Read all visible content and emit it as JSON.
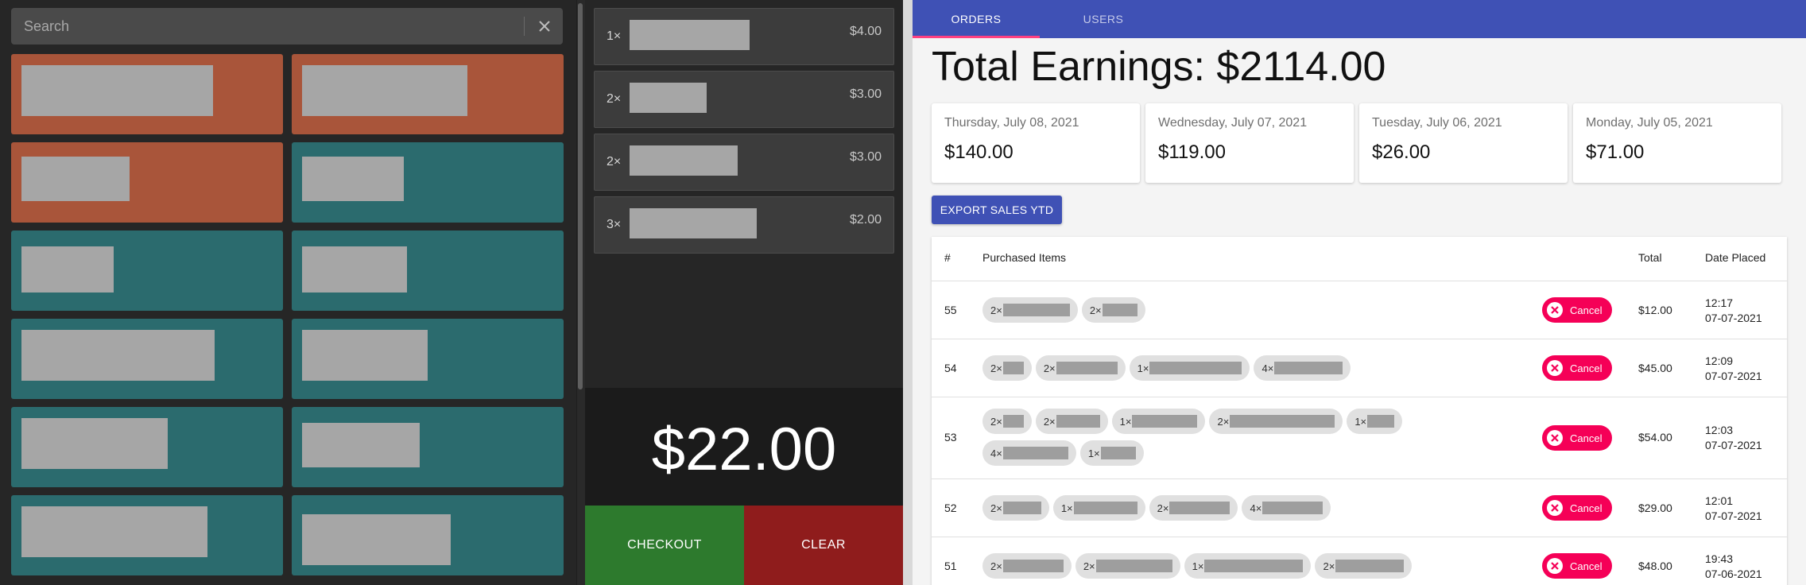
{
  "search": {
    "placeholder": "Search"
  },
  "tiles": [
    {
      "color": "orange"
    },
    {
      "color": "orange"
    },
    {
      "color": "orange"
    },
    {
      "color": "teal"
    },
    {
      "color": "teal"
    },
    {
      "color": "teal"
    },
    {
      "color": "teal"
    },
    {
      "color": "teal"
    },
    {
      "color": "teal"
    },
    {
      "color": "teal"
    },
    {
      "color": "teal"
    },
    {
      "color": "teal"
    }
  ],
  "cart": {
    "items": [
      {
        "qty": "1×",
        "price": "$4.00"
      },
      {
        "qty": "2×",
        "price": "$3.00"
      },
      {
        "qty": "2×",
        "price": "$3.00"
      },
      {
        "qty": "3×",
        "price": "$2.00"
      }
    ],
    "total": "$22.00",
    "checkout_label": "CHECKOUT",
    "clear_label": "CLEAR"
  },
  "tabs": [
    {
      "label": "ORDERS",
      "active": true
    },
    {
      "label": "USERS",
      "active": false
    }
  ],
  "earnings_title": "Total Earnings: $2114.00",
  "daily": [
    {
      "date": "Thursday, July 08, 2021",
      "amount": "$140.00"
    },
    {
      "date": "Wednesday, July 07, 2021",
      "amount": "$119.00"
    },
    {
      "date": "Tuesday, July 06, 2021",
      "amount": "$26.00"
    },
    {
      "date": "Monday, July 05, 2021",
      "amount": "$71.00"
    }
  ],
  "export_label": "EXPORT SALES YTD",
  "table": {
    "headers": {
      "id": "#",
      "items": "Purchased Items",
      "total": "Total",
      "date": "Date Placed"
    },
    "cancel_label": "Cancel",
    "orders": [
      {
        "id": "55",
        "items": [
          "2×",
          "2×"
        ],
        "total": "$12.00",
        "time": "12:17",
        "date": "07-07-2021"
      },
      {
        "id": "54",
        "items": [
          "2×",
          "2×",
          "1×",
          "4×"
        ],
        "total": "$45.00",
        "time": "12:09",
        "date": "07-07-2021"
      },
      {
        "id": "53",
        "items": [
          "2×",
          "2×",
          "1×",
          "2×",
          "1×",
          "4×",
          "1×"
        ],
        "total": "$54.00",
        "time": "12:03",
        "date": "07-07-2021"
      },
      {
        "id": "52",
        "items": [
          "2×",
          "1×",
          "2×",
          "4×"
        ],
        "total": "$29.00",
        "time": "12:01",
        "date": "07-07-2021"
      },
      {
        "id": "51",
        "items": [
          "2×",
          "2×",
          "1×",
          "2×"
        ],
        "total": "$48.00",
        "time": "19:43",
        "date": "07-06-2021"
      }
    ]
  }
}
